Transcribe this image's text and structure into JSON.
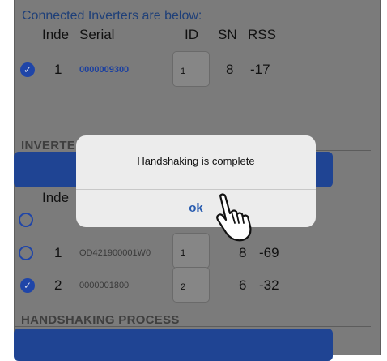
{
  "connected": {
    "title": "Connected Inverters are below:",
    "headers": {
      "index": "Inde",
      "serial": "Serial",
      "id": "ID",
      "sn": "SN",
      "rss": "RSS"
    },
    "row": {
      "index": "1",
      "serial": "0000009300",
      "id": "1",
      "sn": "8",
      "rss": "-17",
      "checked": true
    }
  },
  "inverters_section": {
    "label": "INVERTE",
    "headers": {
      "index": "Inde"
    },
    "rows": [
      {
        "index": "1",
        "serial": "OD421900001W0",
        "id": "1",
        "sn": "8",
        "rss": "-69",
        "checked": false
      },
      {
        "index": "2",
        "serial": "0000001800",
        "id": "2",
        "sn": "6",
        "rss": "-32",
        "checked": true
      }
    ]
  },
  "handshaking": {
    "label": "HANDSHAKING PROCESS"
  },
  "dialog": {
    "message": "Handshaking is complete",
    "ok_label": "ok"
  },
  "icons": {
    "check": "checkmark-icon",
    "radio": "radio-empty-icon",
    "pointer": "hand-pointer-icon"
  },
  "colors": {
    "accent": "#1f45a8",
    "overlay_gray": "#7b7b7b",
    "dialog_bg": "#ececec",
    "ok_text": "#2a5db0"
  }
}
